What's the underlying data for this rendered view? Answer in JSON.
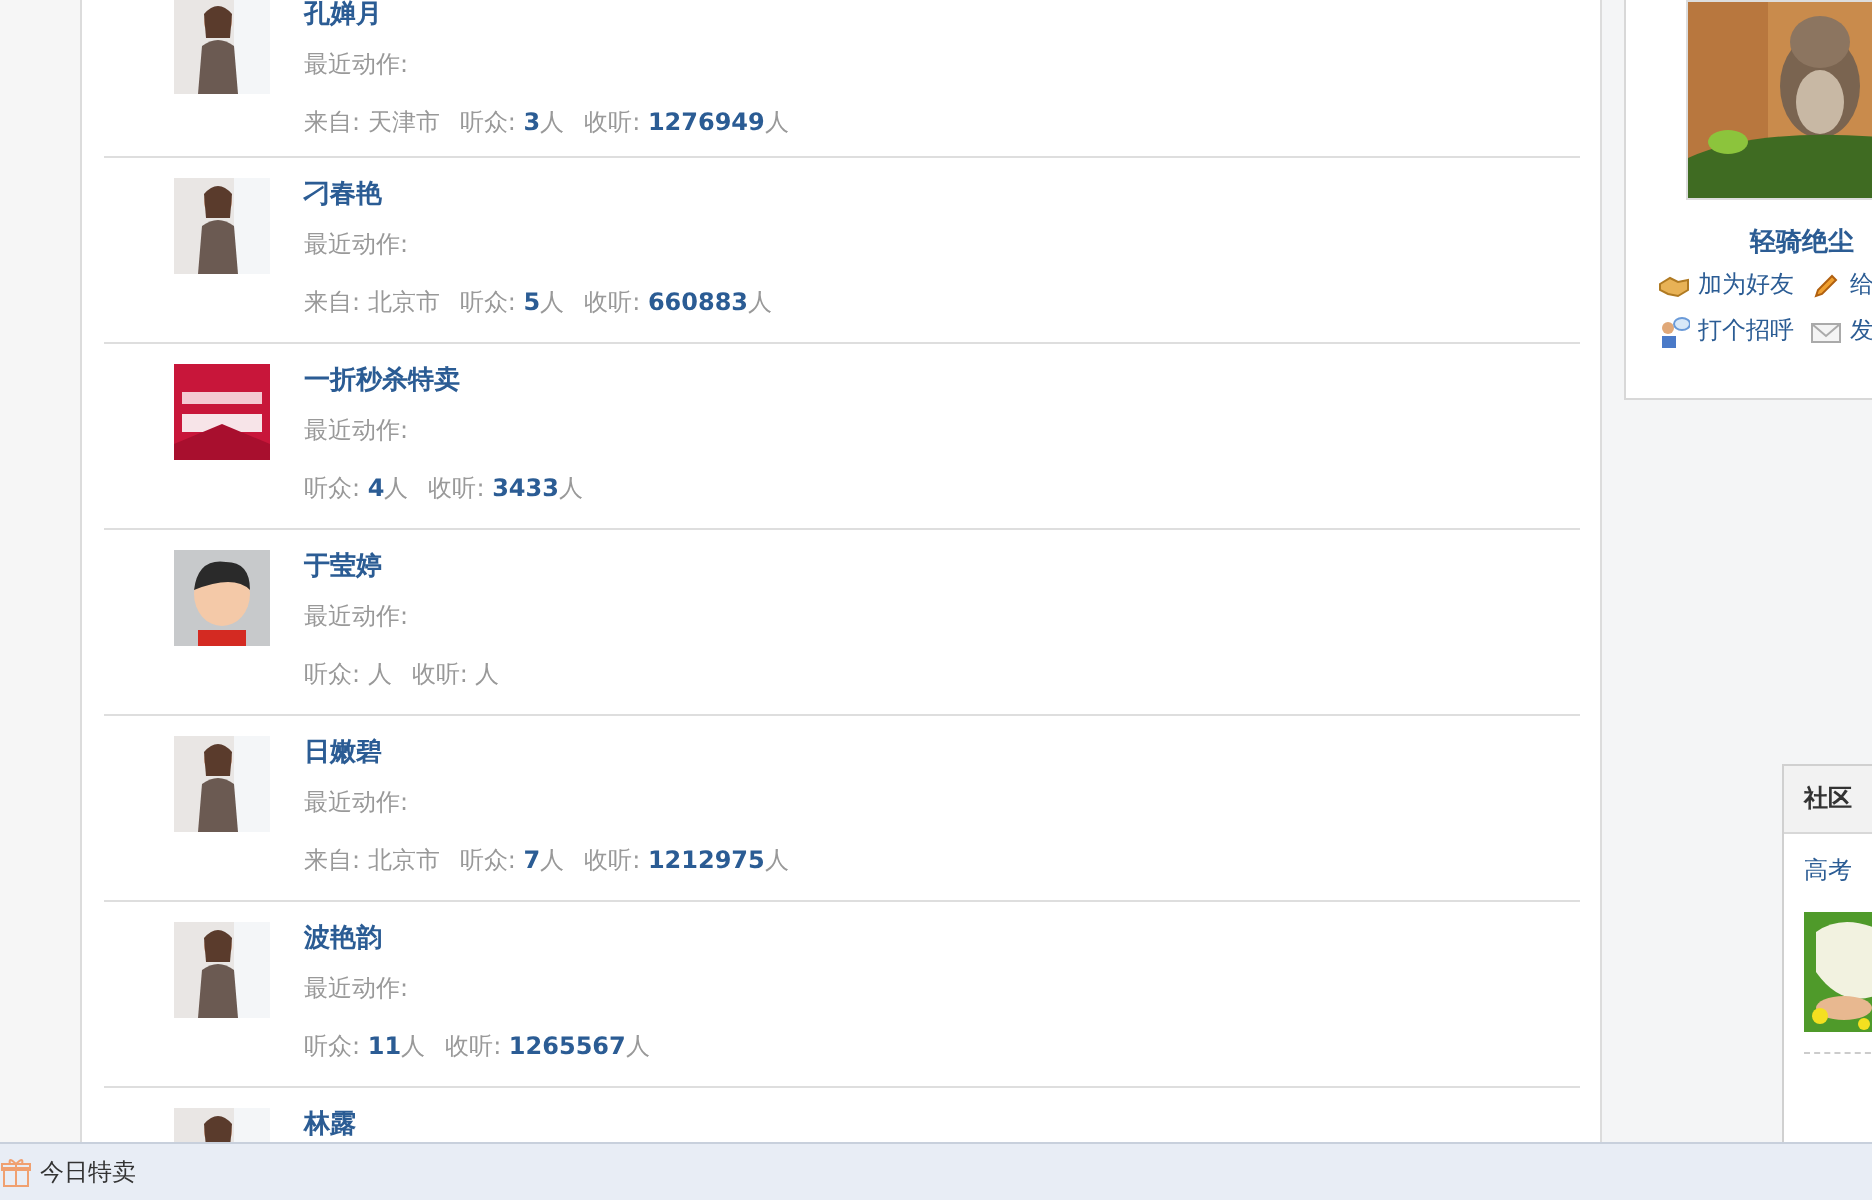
{
  "users": [
    {
      "name": "孔婵月",
      "action": "最近动作:",
      "location": "来自: 天津市",
      "stats": [
        {
          "label": "听众:",
          "value": "3",
          "unit": "人"
        },
        {
          "label": "收听:",
          "value": "1276949",
          "unit": "人"
        }
      ]
    },
    {
      "name": "刁春艳",
      "action": "最近动作:",
      "location": "来自: 北京市",
      "stats": [
        {
          "label": "听众:",
          "value": "5",
          "unit": "人"
        },
        {
          "label": "收听:",
          "value": "660883",
          "unit": "人"
        }
      ]
    },
    {
      "name": "一折秒杀特卖",
      "action": "最近动作:",
      "stats": [
        {
          "label": "听众:",
          "value": "4",
          "unit": "人"
        },
        {
          "label": "收听:",
          "value": "3433",
          "unit": "人"
        }
      ]
    },
    {
      "name": "于莹婷",
      "action": "最近动作:",
      "stats": [
        {
          "label": "听众:",
          "unit": "人"
        },
        {
          "label": "收听:",
          "unit": "人"
        }
      ]
    },
    {
      "name": "日嫩碧",
      "action": "最近动作:",
      "location": "来自: 北京市",
      "stats": [
        {
          "label": "听众:",
          "value": "7",
          "unit": "人"
        },
        {
          "label": "收听:",
          "value": "1212975",
          "unit": "人"
        }
      ]
    },
    {
      "name": "波艳韵",
      "action": "最近动作:",
      "stats": [
        {
          "label": "听众:",
          "value": "11",
          "unit": "人"
        },
        {
          "label": "收听:",
          "value": "1265567",
          "unit": "人"
        }
      ]
    },
    {
      "name": "林露"
    }
  ],
  "profile": {
    "name": "轻骑绝尘",
    "actions": [
      {
        "label": "加为好友",
        "kind": "friend"
      },
      {
        "label": "给",
        "kind": "write"
      },
      {
        "label": "打个招呼",
        "kind": "greet"
      },
      {
        "label": "发",
        "kind": "mail"
      }
    ]
  },
  "recommend": {
    "title": "社区",
    "link": "高考"
  },
  "status_bar": {
    "label": "今日特卖"
  }
}
